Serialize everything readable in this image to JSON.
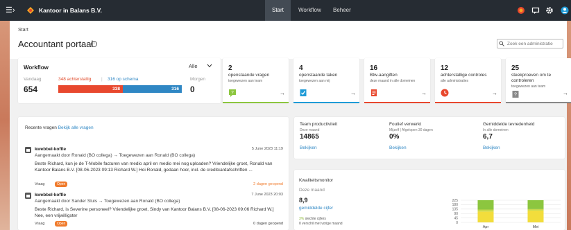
{
  "app": {
    "brand": "Kantoor in Balans B.V.",
    "nav": [
      "Start",
      "Workflow",
      "Beheer"
    ]
  },
  "page": {
    "breadcrumb": "Start",
    "title": "Accountant portaal",
    "search_placeholder": "Zoek een administratie"
  },
  "workflow": {
    "title": "Workflow",
    "filter": "Alle",
    "today_label": "Vandaag",
    "today_value": "654",
    "overdue_text": "348 achterstallig",
    "sep": "|",
    "ontime_text": "316 op schema",
    "overdue_bar": "338",
    "ontime_bar": "316",
    "overdue_share": 0.52,
    "tomorrow_label": "Morgen",
    "tomorrow_value": "0"
  },
  "tiles": [
    {
      "num": "2",
      "title": "openstaande vragen",
      "sub": "toegewezen aan team",
      "icon": "chat-icon",
      "color": "#8cc63f"
    },
    {
      "num": "4",
      "title": "openstaande taken",
      "sub": "toegewezen aan mij",
      "icon": "task-icon",
      "color": "#1f9bd7"
    },
    {
      "num": "16",
      "title": "Btw-aangiften",
      "sub": "deze maand in alle domeinen",
      "icon": "document-icon",
      "color": "#e8482e"
    },
    {
      "num": "12",
      "title": "achterstallige controles",
      "sub": "alle administraties",
      "icon": "clock-icon",
      "color": "#e8482e"
    },
    {
      "num": "25",
      "title": "steekproeven om te controleren",
      "sub": "toegewezen aan team",
      "icon": "sample-icon",
      "color": "#888888"
    }
  ],
  "questions": {
    "header": "Recente vragen",
    "link": "Bekijk alle vragen",
    "items": [
      {
        "name": "kwebbel-koffie",
        "date": "5 June 2023 11:19",
        "sub": "Aangemaakt door Ronald (BO collega)  →  Toegewezen aan Ronald (BO collega)",
        "body": "Beste Richard, kun je de T-Mobile facturen van medio april en medio mei nog uploaden? Vriendelijke groet, Ronald van Kantoor Balans B.V. [08-06-2023 09:13 Richard W.] Hoi Ronald, gedaan hoor, incl. de creditcardafschriften ...",
        "type": "Vraag",
        "status": "Open",
        "due": "2 dagen geopend",
        "due_color": "#f07b2c"
      },
      {
        "name": "kwebbel-koffie",
        "date": "7 June 2023 20:03",
        "sub": "Aangemaakt door Sander Sluis  →  Toegewezen aan Ronald (BO collega)",
        "body": "Beste Richard, is Severine personeel? Vriendelijke groet, Sindy van Kantoor Balans B.V. [08-06-2023 09:06 Richard W.] Nee, een vrijwilligster",
        "type": "Vraag",
        "status": "Open",
        "due": "0 dagen geopend",
        "due_color": "#444444"
      }
    ]
  },
  "stats": [
    {
      "title": "Team productiviteit",
      "sub": "Deze maand",
      "value": "14865",
      "link": "Bekijken"
    },
    {
      "title": "Foutief verwerkt",
      "sub": "Mijzelf | Afgelopen 30 dagen",
      "value": "0%",
      "link": "Bekijken"
    },
    {
      "title": "Gemiddelde tevredenheid",
      "sub": "In alle domeinen",
      "value": "6,7",
      "link": "Bekijken"
    }
  ],
  "quality": {
    "title": "Kwaliteitsmonitor",
    "sub": "Deze maand",
    "value": "8,9",
    "link": "gemiddelde cijfer",
    "pct": "3%",
    "pct_text": " slechte cijfers",
    "change": "0 verschil met vorige maand"
  },
  "chart_data": {
    "type": "bar",
    "categories": [
      "Apr",
      "Mei"
    ],
    "yticks": [
      "225",
      "180",
      "135",
      "90",
      "45",
      "0"
    ],
    "ylim": [
      0,
      225
    ],
    "series": [
      {
        "values": [
          110,
          120
        ],
        "color": "#f2dd3c"
      },
      {
        "values": [
          20,
          15
        ],
        "color": "#c9d94a"
      },
      {
        "values": [
          95,
          90
        ],
        "color": "#8cc63f"
      }
    ]
  }
}
